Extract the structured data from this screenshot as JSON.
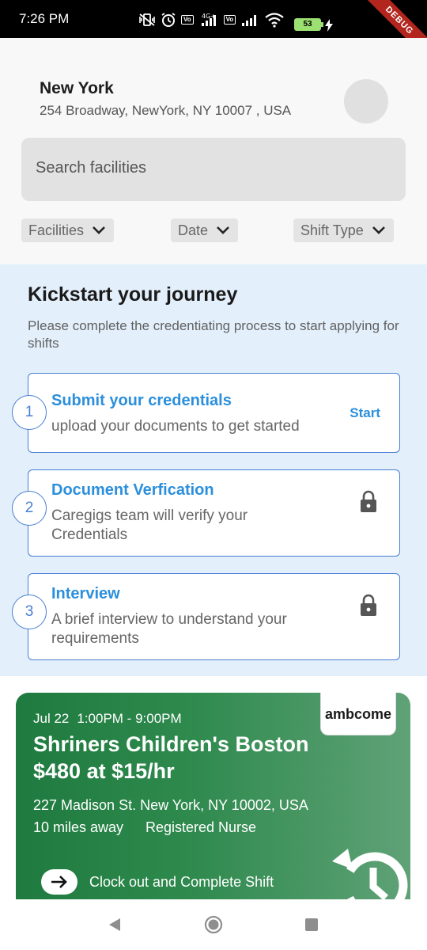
{
  "status_bar": {
    "time": "7:26 PM",
    "network_label": "4G+",
    "battery": "53",
    "debug_label": "DEBUG"
  },
  "location": {
    "city": "New York",
    "address": "254 Broadway, NewYork, NY 10007 , USA"
  },
  "search": {
    "placeholder": "Search facilities"
  },
  "filters": [
    {
      "label": "Facilities"
    },
    {
      "label": "Date"
    },
    {
      "label": "Shift Type"
    }
  ],
  "kickstart": {
    "title": "Kickstart your journey",
    "subtitle": "Please complete the credentiating process to start applying for shifts",
    "steps": [
      {
        "number": "1",
        "title": "Submit your credentials",
        "description": "upload your documents to get started",
        "action": "Start",
        "icon": ""
      },
      {
        "number": "2",
        "title": "Document Verfication",
        "description": "Caregigs team will verify your Credentials",
        "action": "",
        "icon": "lock-icon"
      },
      {
        "number": "3",
        "title": "Interview",
        "description": "A brief interview to understand your requirements",
        "action": "",
        "icon": "lock-icon"
      }
    ]
  },
  "shift": {
    "company": "ambcome",
    "date": "Jul 22",
    "time": "1:00PM - 9:00PM",
    "facility": "Shriners Children's Boston",
    "pay": "$480 at $15/hr",
    "address": "227 Madison St. New York, NY 10002, USA",
    "distance": "10 miles away",
    "role": "Registered Nurse",
    "action_label": "Clock out and Complete Shift"
  },
  "colors": {
    "accent_blue": "#2b8fdc",
    "card_green": "#1e7a3e",
    "kickstart_bg": "#e3effb"
  }
}
